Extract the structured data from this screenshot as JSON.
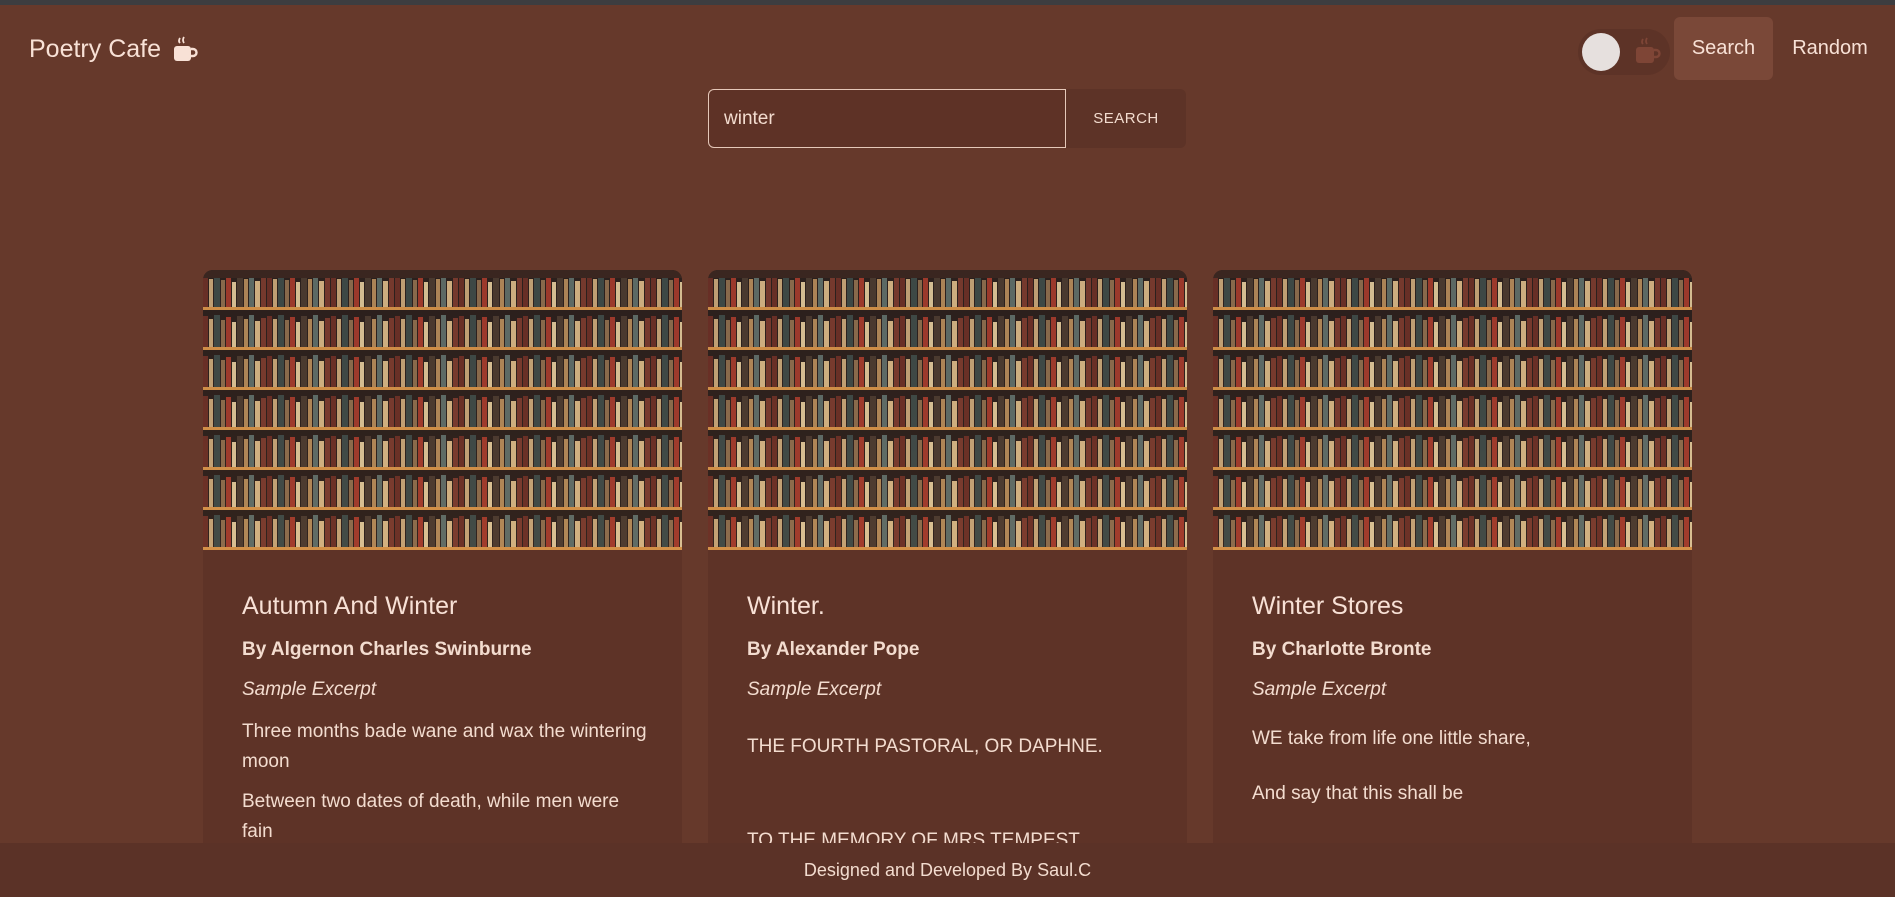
{
  "brand": {
    "title": "Poetry Cafe",
    "icon": "coffee-cup-icon"
  },
  "nav": {
    "theme_toggle": {
      "state": "off",
      "icon": "coffee-cup-icon"
    },
    "search_label": "Search",
    "random_label": "Random"
  },
  "search": {
    "value": "winter",
    "placeholder": "",
    "button_label": "SEARCH"
  },
  "cards": [
    {
      "title": "Autumn And Winter",
      "author": "By Algernon Charles Swinburne",
      "excerpt_label": "Sample Excerpt",
      "image": "bookshelf-photo",
      "lines": [
        "Three months bade wane and wax the wintering moon",
        "Between two dates of death, while men were fain"
      ]
    },
    {
      "title": "Winter.",
      "author": "By Alexander Pope",
      "excerpt_label": "Sample Excerpt",
      "image": "bookshelf-photo",
      "lines": [
        "THE FOURTH PASTORAL, OR DAPHNE.",
        "TO THE MEMORY OF MRS TEMPEST."
      ]
    },
    {
      "title": "Winter Stores",
      "author": "By Charlotte Bronte",
      "excerpt_label": "Sample Excerpt",
      "image": "bookshelf-photo",
      "lines": [
        "WE take from life one little share,",
        "And say that this shall be"
      ]
    }
  ],
  "footer": {
    "text": "Designed and Developed By Saul.C"
  },
  "colors": {
    "background": "#66392b",
    "card": "#5e3327",
    "footer": "#5b3227",
    "text": "#f3dccf"
  }
}
